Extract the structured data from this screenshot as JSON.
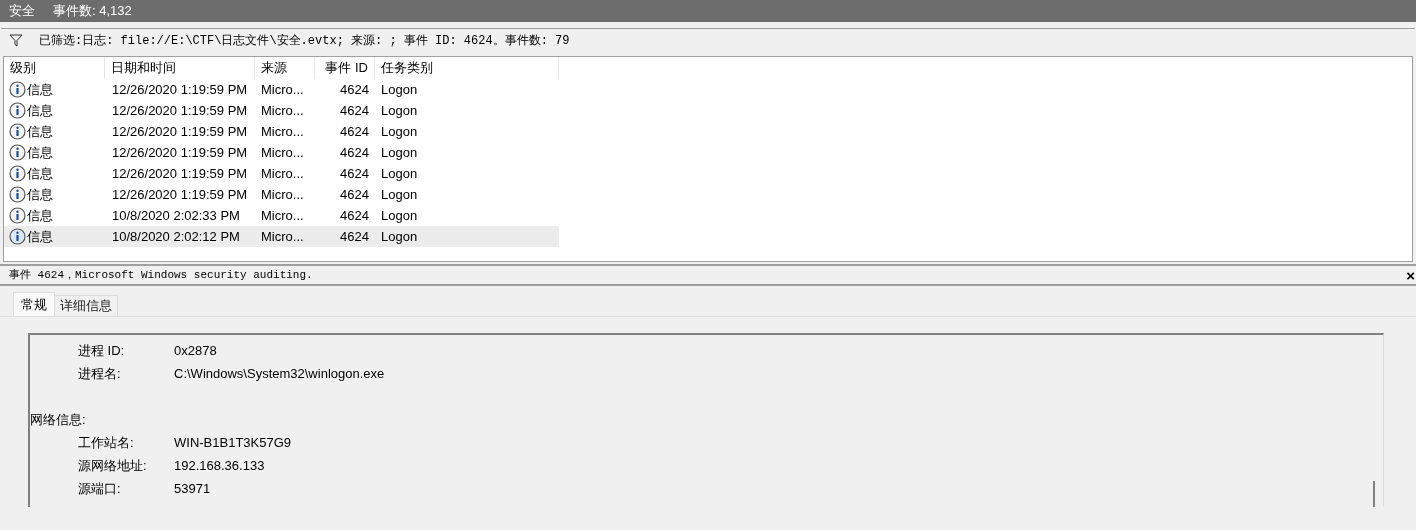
{
  "title_bar": {
    "log_name": "安全",
    "event_count": "事件数: 4,132"
  },
  "filter_bar": {
    "text": "已筛选:日志: file://E:\\CTF\\日志文件\\安全.evtx; 来源: ; 事件 ID: 4624。事件数: 79"
  },
  "table": {
    "columns": [
      "级别",
      "日期和时间",
      "来源",
      "事件 ID",
      "任务类别"
    ],
    "rows": [
      {
        "level": "信息",
        "datetime": "12/26/2020 1:19:59 PM",
        "source": "Micro...",
        "event_id": "4624",
        "task": "Logon",
        "selected": false
      },
      {
        "level": "信息",
        "datetime": "12/26/2020 1:19:59 PM",
        "source": "Micro...",
        "event_id": "4624",
        "task": "Logon",
        "selected": false
      },
      {
        "level": "信息",
        "datetime": "12/26/2020 1:19:59 PM",
        "source": "Micro...",
        "event_id": "4624",
        "task": "Logon",
        "selected": false
      },
      {
        "level": "信息",
        "datetime": "12/26/2020 1:19:59 PM",
        "source": "Micro...",
        "event_id": "4624",
        "task": "Logon",
        "selected": false
      },
      {
        "level": "信息",
        "datetime": "12/26/2020 1:19:59 PM",
        "source": "Micro...",
        "event_id": "4624",
        "task": "Logon",
        "selected": false
      },
      {
        "level": "信息",
        "datetime": "12/26/2020 1:19:59 PM",
        "source": "Micro...",
        "event_id": "4624",
        "task": "Logon",
        "selected": false
      },
      {
        "level": "信息",
        "datetime": "10/8/2020 2:02:33 PM",
        "source": "Micro...",
        "event_id": "4624",
        "task": "Logon",
        "selected": false
      },
      {
        "level": "信息",
        "datetime": "10/8/2020 2:02:12 PM",
        "source": "Micro...",
        "event_id": "4624",
        "task": "Logon",
        "selected": true
      }
    ]
  },
  "detail": {
    "title": "事件 4624，Microsoft Windows security auditing.",
    "close": "×",
    "tabs": [
      {
        "label": "常规",
        "selected": true
      },
      {
        "label": "详细信息",
        "selected": false
      }
    ],
    "lines": [
      {
        "kind": "field",
        "label": "进程 ID:",
        "value": "0x2878"
      },
      {
        "kind": "field",
        "label": "进程名:",
        "value": "C:\\Windows\\System32\\winlogon.exe"
      },
      {
        "kind": "section",
        "label": "网络信息:"
      },
      {
        "kind": "field",
        "label": "工作站名:",
        "value": "WIN-B1B1T3K57G9"
      },
      {
        "kind": "field",
        "label": "源网络地址:",
        "value": "192.168.36.133"
      },
      {
        "kind": "field",
        "label": "源端口:",
        "value": "53971"
      }
    ]
  }
}
